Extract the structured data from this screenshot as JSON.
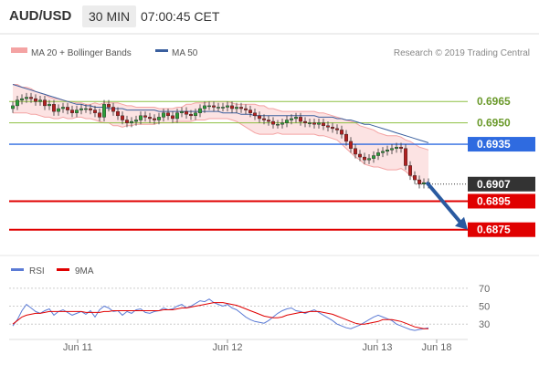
{
  "header": {
    "symbol": "AUD/USD",
    "interval": "30 MIN",
    "time": "07:00:45 CET"
  },
  "colors": {
    "ma20_band": "#f4a3a3",
    "ma50": "#3a5f9e",
    "rsi": "#5b7bd5",
    "rsi_ma": "#e00000",
    "last_price": "#333333",
    "target": "#e00000",
    "pivot": "#2f6be0",
    "resistance": "#8ec043",
    "bull": "#2d9f3a",
    "bear": "#b22020"
  },
  "chart_data": [
    {
      "type": "candlestick",
      "legend": [
        "MA 20 + Bollinger Bands",
        "MA 50"
      ],
      "credit": "Research © 2019 Trading Central",
      "x_ticks": [
        "Jun 11",
        "Jun 12",
        "Jun 13",
        "Jun 18"
      ],
      "ylim": [
        0.6862,
        0.6985
      ],
      "levels": [
        {
          "value": 0.6965,
          "label": "0.6965",
          "kind": "resistance"
        },
        {
          "value": 0.695,
          "label": "0.6950",
          "kind": "resistance"
        },
        {
          "value": 0.6935,
          "label": "0.6935",
          "kind": "pivot"
        },
        {
          "value": 0.6907,
          "label": "0.6907",
          "kind": "last"
        },
        {
          "value": 0.6895,
          "label": "0.6895",
          "kind": "target"
        },
        {
          "value": 0.6875,
          "label": "0.6875",
          "kind": "target"
        }
      ],
      "close": [
        0.6962,
        0.6966,
        0.6967,
        0.6968,
        0.6967,
        0.6965,
        0.6966,
        0.6962,
        0.6963,
        0.6958,
        0.696,
        0.6961,
        0.6959,
        0.6957,
        0.6959,
        0.696,
        0.696,
        0.6959,
        0.6957,
        0.6954,
        0.6963,
        0.6961,
        0.6958,
        0.6955,
        0.6952,
        0.695,
        0.6951,
        0.6952,
        0.6955,
        0.6954,
        0.6953,
        0.6952,
        0.6954,
        0.6957,
        0.6955,
        0.6953,
        0.6957,
        0.6958,
        0.6956,
        0.6955,
        0.6957,
        0.696,
        0.6962,
        0.6962,
        0.6961,
        0.6961,
        0.6961,
        0.6962,
        0.696,
        0.6961,
        0.696,
        0.6959,
        0.6957,
        0.6955,
        0.6953,
        0.6952,
        0.6951,
        0.6949,
        0.6949,
        0.695,
        0.6952,
        0.6953,
        0.6954,
        0.6951,
        0.695,
        0.695,
        0.6949,
        0.695,
        0.6948,
        0.6947,
        0.6946,
        0.6945,
        0.6942,
        0.6937,
        0.6932,
        0.6928,
        0.6926,
        0.6924,
        0.6925,
        0.6927,
        0.6929,
        0.693,
        0.6931,
        0.6932,
        0.6933,
        0.6932,
        0.692,
        0.6913,
        0.691,
        0.6907,
        0.6908,
        0.6907
      ],
      "ma20": [
        0.6967,
        0.6967,
        0.6966,
        0.6966,
        0.6965,
        0.6964,
        0.6963,
        0.6962,
        0.6961,
        0.696,
        0.696,
        0.696,
        0.6959,
        0.6959,
        0.6959,
        0.6959,
        0.6958,
        0.6958,
        0.6958,
        0.6957,
        0.6957,
        0.6957,
        0.6956,
        0.6956,
        0.6955,
        0.6955,
        0.6955,
        0.6955,
        0.6955,
        0.6955,
        0.6955,
        0.6955,
        0.6955,
        0.6955,
        0.6955,
        0.6955,
        0.6956,
        0.6956,
        0.6957,
        0.6957,
        0.6958,
        0.6958,
        0.6958,
        0.6959,
        0.6959,
        0.6959,
        0.6959,
        0.6959,
        0.6958,
        0.6957,
        0.6956,
        0.6955,
        0.6954,
        0.6953,
        0.6952,
        0.6952,
        0.6951,
        0.6951,
        0.6951,
        0.695,
        0.695,
        0.695,
        0.695,
        0.695,
        0.695,
        0.695,
        0.695,
        0.6949,
        0.6949,
        0.6948,
        0.6947,
        0.6946,
        0.6944,
        0.6942,
        0.694,
        0.6938,
        0.6936,
        0.6934,
        0.6933,
        0.6932,
        0.6931,
        0.693,
        0.6929,
        0.6929,
        0.6929,
        0.6929,
        0.6927,
        0.6925,
        0.6923,
        0.6921,
        0.692,
        0.6919
      ],
      "bb_width": [
        0.001,
        0.001,
        0.0009,
        0.0009,
        0.0009,
        0.0008,
        0.0008,
        0.0008,
        0.0007,
        0.0007,
        0.0007,
        0.0006,
        0.0006,
        0.0006,
        0.0005,
        0.0005,
        0.0005,
        0.0005,
        0.0006,
        0.0006,
        0.0007,
        0.0007,
        0.0008,
        0.0008,
        0.0008,
        0.0007,
        0.0007,
        0.0006,
        0.0006,
        0.0006,
        0.0006,
        0.0006,
        0.0005,
        0.0005,
        0.0005,
        0.0005,
        0.0005,
        0.0005,
        0.0006,
        0.0006,
        0.0006,
        0.0006,
        0.0006,
        0.0006,
        0.0006,
        0.0006,
        0.0006,
        0.0006,
        0.0006,
        0.0006,
        0.0007,
        0.0008,
        0.0009,
        0.001,
        0.001,
        0.001,
        0.0009,
        0.0009,
        0.0008,
        0.0008,
        0.0008,
        0.0008,
        0.0008,
        0.0008,
        0.0008,
        0.0008,
        0.0008,
        0.0008,
        0.0008,
        0.0008,
        0.0008,
        0.0008,
        0.0009,
        0.001,
        0.0011,
        0.0012,
        0.0012,
        0.0013,
        0.0013,
        0.0013,
        0.0012,
        0.0012,
        0.0012,
        0.0012,
        0.0012,
        0.0011,
        0.0011,
        0.0012,
        0.0012,
        0.0012,
        0.0012,
        0.0012
      ],
      "ma50": [
        0.6977,
        0.6976,
        0.6975,
        0.6974,
        0.6973,
        0.6972,
        0.6971,
        0.697,
        0.6969,
        0.6968,
        0.6967,
        0.6966,
        0.6965,
        0.6964,
        0.6963,
        0.6963,
        0.6962,
        0.6962,
        0.6961,
        0.6961,
        0.6961,
        0.696,
        0.696,
        0.696,
        0.696,
        0.6959,
        0.6959,
        0.6959,
        0.6959,
        0.6959,
        0.6959,
        0.6959,
        0.6958,
        0.6958,
        0.6958,
        0.6958,
        0.6958,
        0.6958,
        0.6958,
        0.6958,
        0.6958,
        0.6958,
        0.6958,
        0.6958,
        0.6958,
        0.6958,
        0.6957,
        0.6957,
        0.6957,
        0.6957,
        0.6956,
        0.6956,
        0.6956,
        0.6955,
        0.6955,
        0.6955,
        0.6955,
        0.6955,
        0.6955,
        0.6955,
        0.6955,
        0.6955,
        0.6955,
        0.6955,
        0.6955,
        0.6955,
        0.6955,
        0.6954,
        0.6954,
        0.6954,
        0.6954,
        0.6953,
        0.6953,
        0.6952,
        0.6952,
        0.6951,
        0.695,
        0.6949,
        0.6949,
        0.6948,
        0.6947,
        0.6946,
        0.6945,
        0.6944,
        0.6943,
        0.6942,
        0.6941,
        0.694,
        0.6939,
        0.6938,
        0.6937,
        0.6936
      ]
    },
    {
      "type": "line",
      "legend": [
        "RSI",
        "9MA"
      ],
      "y_ticks": [
        "70",
        "50",
        "30"
      ],
      "ylim": [
        15,
        80
      ],
      "rsi": [
        28,
        35,
        45,
        52,
        48,
        44,
        42,
        45,
        47,
        40,
        44,
        46,
        43,
        40,
        42,
        44,
        41,
        45,
        38,
        46,
        50,
        48,
        44,
        45,
        40,
        44,
        42,
        46,
        47,
        43,
        42,
        44,
        45,
        48,
        46,
        47,
        50,
        52,
        48,
        50,
        53,
        56,
        55,
        58,
        54,
        52,
        50,
        52,
        48,
        46,
        42,
        38,
        35,
        33,
        32,
        31,
        34,
        38,
        42,
        45,
        47,
        48,
        45,
        44,
        42,
        44,
        46,
        43,
        40,
        37,
        34,
        30,
        28,
        26,
        25,
        27,
        29,
        32,
        35,
        38,
        40,
        38,
        36,
        34,
        30,
        28,
        26,
        24,
        23,
        24,
        25,
        26
      ],
      "rsi_ma": [
        30,
        34,
        38,
        40,
        41,
        42,
        42,
        43,
        44,
        44,
        44,
        44,
        44,
        44,
        44,
        44,
        43,
        43,
        43,
        43,
        44,
        44,
        45,
        45,
        45,
        45,
        45,
        45,
        45,
        45,
        45,
        45,
        45,
        46,
        46,
        46,
        47,
        48,
        48,
        49,
        50,
        51,
        52,
        53,
        54,
        54,
        54,
        53,
        52,
        51,
        49,
        47,
        45,
        43,
        41,
        39,
        38,
        37,
        37,
        38,
        40,
        41,
        42,
        43,
        43,
        44,
        44,
        44,
        43,
        42,
        41,
        39,
        37,
        35,
        33,
        31,
        30,
        30,
        31,
        32,
        33,
        35,
        35,
        35,
        34,
        33,
        31,
        29,
        27,
        26,
        25,
        25
      ]
    }
  ]
}
